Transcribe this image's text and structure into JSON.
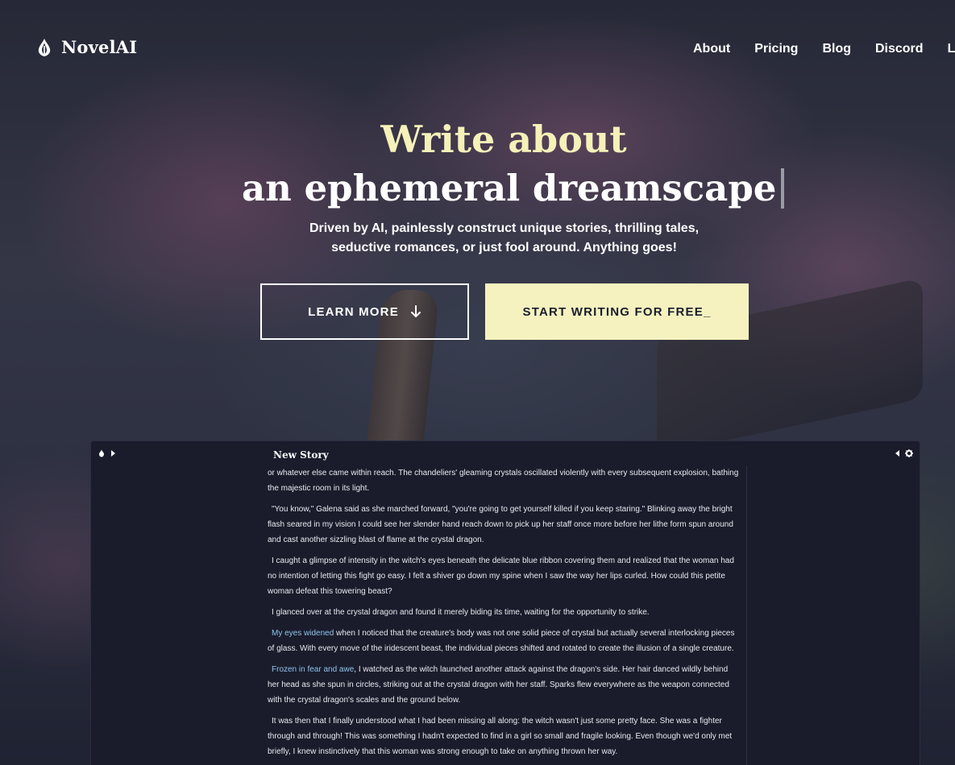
{
  "brand": {
    "name": "NovelAI"
  },
  "nav": {
    "items": [
      "About",
      "Pricing",
      "Blog",
      "Discord",
      "Login"
    ]
  },
  "hero": {
    "title_line1": "Write about",
    "title_line2": "an ephemeral dreamscape",
    "subtitle_line1": "Driven by AI, painlessly construct unique stories, thrilling tales,",
    "subtitle_line2": "seductive romances, or just fool around. Anything goes!",
    "learn_more_label": "LEARN MORE",
    "start_label": "START WRITING FOR FREE_"
  },
  "editor": {
    "story_title": "New Story",
    "paragraphs": [
      {
        "highlight": "",
        "text": "or whatever else came within reach. The chandeliers' gleaming crystals oscillated violently with every subsequent explosion, bathing the majestic room in its light."
      },
      {
        "highlight": "",
        "text": "\"You know,\" Galena said as she marched forward, \"you're going to get yourself killed if you keep staring.\" Blinking away the bright flash seared in my vision I could see her slender hand reach down to pick up her staff once more before her lithe form spun around and cast another sizzling blast of flame at the crystal dragon."
      },
      {
        "highlight": "",
        "text": "I caught a glimpse of intensity in the witch's eyes beneath the delicate blue ribbon covering them and realized that the woman had no intention of letting this fight go easy. I felt a shiver go down my spine when I saw the way her lips curled. How could this petite woman defeat this towering beast?"
      },
      {
        "highlight": "",
        "text": "I glanced over at the crystal dragon and found it merely biding its time, waiting for the opportunity to strike."
      },
      {
        "highlight": "My eyes widened",
        "text": " when I noticed that the creature's body was not one solid piece of crystal but actually several interlocking pieces of glass. With every move of the iridescent beast, the individual pieces shifted and rotated to create the illusion of a single creature."
      },
      {
        "highlight": "Frozen in fear and awe",
        "text": ", I watched as the witch launched another attack against the dragon's side. Her hair danced wildly behind her head as she spun in circles, striking out at the crystal dragon with her staff. Sparks flew everywhere as the weapon connected with the crystal dragon's scales and the ground below."
      },
      {
        "highlight": "",
        "text": "It was then that I finally understood what I had been missing all along: the witch wasn't just some pretty face. She was a fighter through and through! This was something I hadn't expected to find in a girl so small and fragile looking. Even though we'd only met briefly, I knew instinctively that this woman was strong enough to take on anything thrown her way."
      }
    ]
  },
  "colors": {
    "accent": "#f5f1b9",
    "button_bg": "#f5f2c0",
    "editor_bg": "#1a1c2c",
    "highlight": "#8ec4ea"
  },
  "icons": {
    "logo": "quill-logo-icon",
    "learn_more": "arrow-down-icon",
    "editor_left": [
      "quill-small-icon",
      "caret-right-icon"
    ],
    "editor_right": [
      "caret-left-icon",
      "gear-icon"
    ]
  }
}
